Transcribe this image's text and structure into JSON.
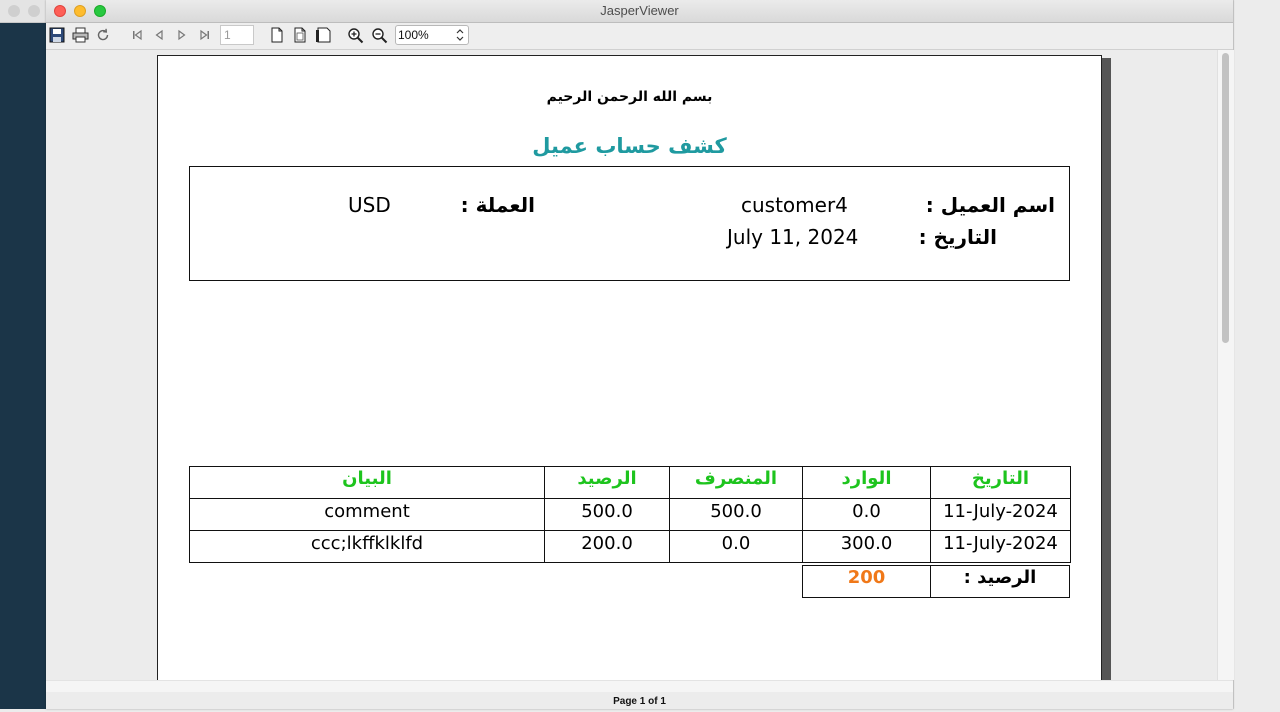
{
  "window": {
    "title": "JasperViewer"
  },
  "toolbar": {
    "page_number": "1",
    "zoom_value": "100%"
  },
  "status": {
    "page_text": "Page 1 of 1"
  },
  "report": {
    "basmala": "بسم الله الرحمن الرحيم",
    "title": "كشف حساب عميل",
    "customer_label": "اسم العميل :",
    "customer_value": "customer4",
    "currency_label": "العملة :",
    "currency_value": "USD",
    "date_label": "التاريخ :",
    "date_value": "July 11, 2024",
    "columns": {
      "date": "التاريخ",
      "incoming": "الوارد",
      "outgoing": "المنصرف",
      "balance": "الرصيد",
      "description": "البيان"
    },
    "rows": [
      {
        "date": "11-July-2024",
        "incoming": "0.0",
        "outgoing": "500.0",
        "balance": "500.0",
        "description": "comment"
      },
      {
        "date": "11-July-2024",
        "incoming": "300.0",
        "outgoing": "0.0",
        "balance": "200.0",
        "description": "ccc;lkffklklfd"
      }
    ],
    "total_label": "الرصيد :",
    "total_value": "200"
  },
  "colors": {
    "title": "#1f9aa0",
    "header": "#1ec41e",
    "total": "#f07818"
  }
}
